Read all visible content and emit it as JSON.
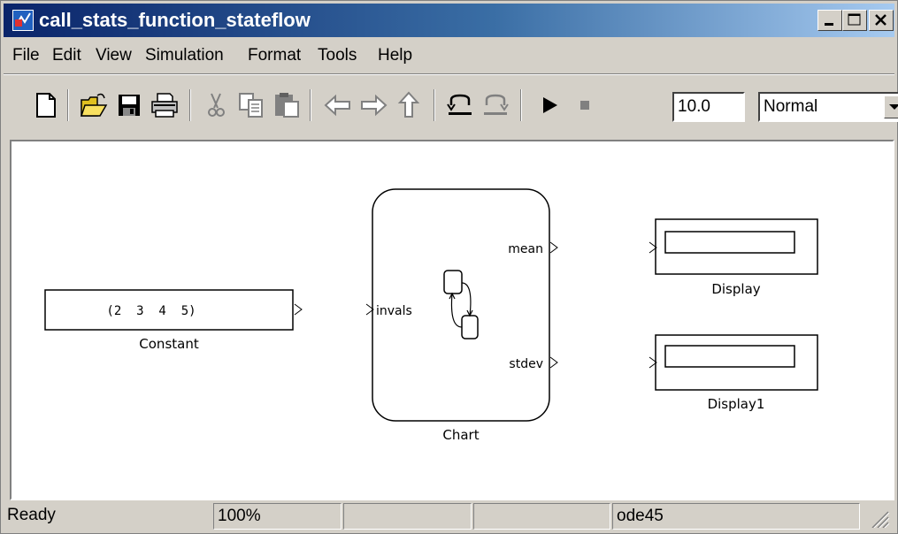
{
  "window": {
    "title": "call_stats_function_stateflow",
    "icon": "simulink-model-icon",
    "controls": [
      "minimize-button",
      "maximize-button",
      "close-button"
    ]
  },
  "menu": {
    "items": [
      "File",
      "Edit",
      "View",
      "Simulation",
      "Format",
      "Tools",
      "Help"
    ]
  },
  "toolbar": {
    "buttons": [
      "new-icon",
      "open-icon",
      "save-icon",
      "print-icon",
      "cut-icon",
      "copy-icon",
      "paste-icon",
      "back-icon",
      "forward-icon",
      "up-icon",
      "undo-icon",
      "redo-icon",
      "start-simulation-icon",
      "stop-simulation-icon"
    ],
    "stop_time": "10.0",
    "sim_mode": "Normal"
  },
  "diagram": {
    "constant": {
      "value": "(2  3  4  5)",
      "name": "Constant"
    },
    "chart": {
      "name": "Chart",
      "input_port": "invals",
      "output_ports": [
        "mean",
        "stdev"
      ]
    },
    "display": {
      "name": "Display"
    },
    "display1": {
      "name": "Display1"
    }
  },
  "status": {
    "state": "Ready",
    "zoom": "100%",
    "field3": "",
    "field4": "",
    "solver": "ode45"
  }
}
